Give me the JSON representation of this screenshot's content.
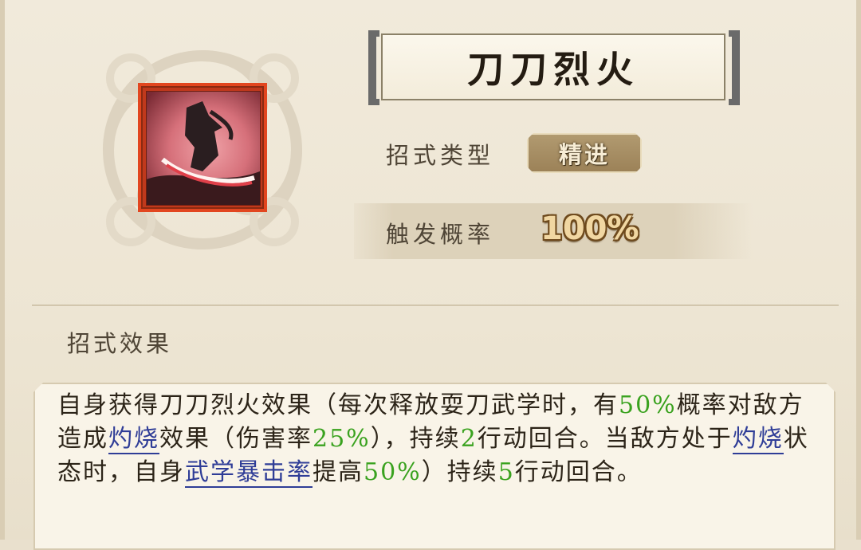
{
  "skill": {
    "name": "刀刀烈火",
    "type_label": "招式类型",
    "type_value": "精进",
    "chance_label": "触发概率",
    "chance_value": "100%"
  },
  "effect": {
    "section_title": "招式效果",
    "segments": [
      {
        "text": "自身获得刀刀烈火效果（每次释放耍刀武学时，有",
        "style": "normal"
      },
      {
        "text": "50%",
        "style": "green"
      },
      {
        "text": "概率对敌方造成",
        "style": "normal"
      },
      {
        "text": "灼烧",
        "style": "keyword"
      },
      {
        "text": "效果（伤害率",
        "style": "normal"
      },
      {
        "text": "25%",
        "style": "green"
      },
      {
        "text": "），持续",
        "style": "normal"
      },
      {
        "text": "2",
        "style": "green"
      },
      {
        "text": "行动回合。当敌方处于",
        "style": "normal"
      },
      {
        "text": "灼烧",
        "style": "keyword"
      },
      {
        "text": "状态时，自身",
        "style": "normal"
      },
      {
        "text": "武学暴击率",
        "style": "keyword"
      },
      {
        "text": "提高",
        "style": "normal"
      },
      {
        "text": "50%",
        "style": "green"
      },
      {
        "text": "）持续",
        "style": "normal"
      },
      {
        "text": "5",
        "style": "green"
      },
      {
        "text": "行动回合。",
        "style": "normal"
      }
    ]
  },
  "colors": {
    "highlight_green": "#3aa21f",
    "keyword_blue": "#2f3d97",
    "icon_border": "#e2461f"
  },
  "icons": {
    "emblem": "cloud-swirl-emblem",
    "skill_art": "sword-slash-ninja-icon"
  }
}
